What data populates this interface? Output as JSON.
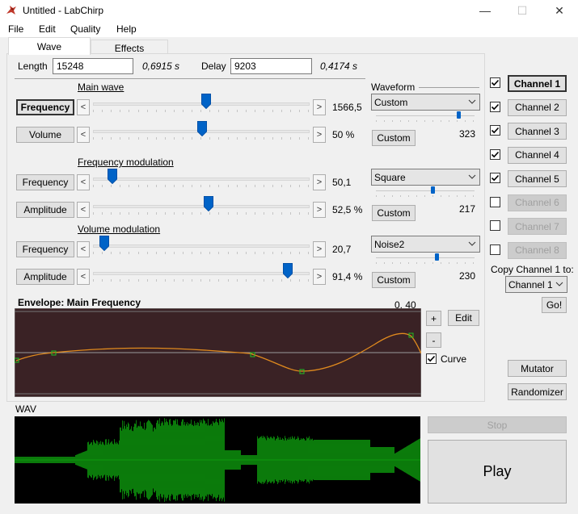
{
  "window": {
    "title": "Untitled - LabChirp",
    "minimize": "—",
    "maximize": "☐",
    "close": "✕"
  },
  "menu": [
    "File",
    "Edit",
    "Quality",
    "Help"
  ],
  "tabs": [
    "Wave",
    "Effects"
  ],
  "top": {
    "length_label": "Length",
    "length_value": "15248",
    "length_seconds": "0,6915 s",
    "delay_label": "Delay",
    "delay_value": "9203",
    "delay_seconds": "0,4174 s"
  },
  "sections": {
    "main_wave": "Main wave",
    "freq_mod": "Frequency modulation",
    "vol_mod": "Volume modulation",
    "waveform": "Waveform"
  },
  "rows": [
    {
      "label": "Frequency",
      "value": "1566,5",
      "level": 0.52
    },
    {
      "label": "Volume",
      "value": "50 %",
      "level": 0.5
    },
    {
      "label": "Frequency",
      "value": "50,1",
      "level": 0.07
    },
    {
      "label": "Amplitude",
      "value": "52,5 %",
      "level": 0.53
    },
    {
      "label": "Frequency",
      "value": "20,7",
      "level": 0.03
    },
    {
      "label": "Amplitude",
      "value": "91,4 %",
      "level": 0.91
    }
  ],
  "waves": [
    {
      "selected": "Custom",
      "value": "323",
      "level": 0.85,
      "button": "Custom"
    },
    {
      "selected": "Square",
      "value": "217",
      "level": 0.58,
      "button": "Custom"
    },
    {
      "selected": "Noise2",
      "value": "230",
      "level": 0.62,
      "button": "Custom"
    }
  ],
  "envelope": {
    "title": "Envelope: Main Frequency",
    "coords": "0, 40",
    "plus": "+",
    "minus": "-",
    "edit": "Edit",
    "curve": "Curve",
    "curve_checked": true
  },
  "channels": [
    {
      "label": "Channel 1",
      "checked": true,
      "active": true,
      "enabled": true
    },
    {
      "label": "Channel 2",
      "checked": true,
      "active": false,
      "enabled": true
    },
    {
      "label": "Channel 3",
      "checked": true,
      "active": false,
      "enabled": true
    },
    {
      "label": "Channel 4",
      "checked": true,
      "active": false,
      "enabled": true
    },
    {
      "label": "Channel 5",
      "checked": true,
      "active": false,
      "enabled": true
    },
    {
      "label": "Channel 6",
      "checked": false,
      "active": false,
      "enabled": false
    },
    {
      "label": "Channel 7",
      "checked": false,
      "active": false,
      "enabled": false
    },
    {
      "label": "Channel 8",
      "checked": false,
      "active": false,
      "enabled": false
    }
  ],
  "copy": {
    "label": "Copy Channel 1 to:",
    "selected": "Channel 1",
    "go": "Go!"
  },
  "side_buttons": {
    "mutator": "Mutator",
    "randomizer": "Randomizer"
  },
  "wav": {
    "label": "WAV",
    "stop": "Stop",
    "play": "Play"
  },
  "colors": {
    "envelope_bg": "#3a2225",
    "wave_bg": "#000000",
    "wave_green": "#0e9a0e",
    "curve": "#e08a1e",
    "accent": "#0063c7"
  }
}
